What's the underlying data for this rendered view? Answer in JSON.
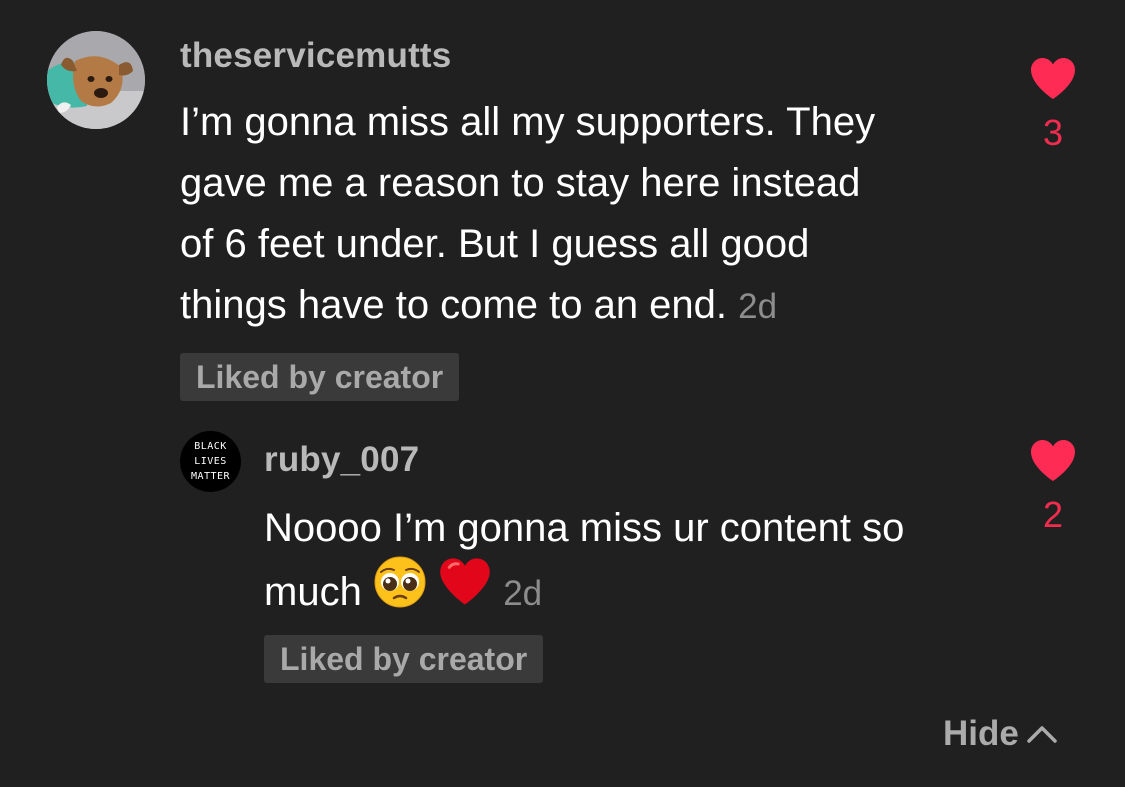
{
  "comment": {
    "username": "theservicemutts",
    "avatar_icon": "dog-avatar",
    "text_lines": [
      "I’m gonna miss all my supporters. They",
      "gave me a reason to stay here instead",
      "of 6 feet under. But I guess all good",
      "things have to come to an end."
    ],
    "time": "2d",
    "badge": "Liked by creator",
    "likes": "3"
  },
  "reply": {
    "username": "ruby_007",
    "avatar_lines": [
      "BLACK",
      "LIVES",
      "MATTER"
    ],
    "text_line1": "Noooo I’m gonna miss ur content so",
    "text_line2": "much",
    "emojis": [
      "pleading-face-emoji",
      "red-heart-emoji"
    ],
    "time": "2d",
    "badge": "Liked by creator",
    "likes": "2"
  },
  "hide": {
    "label": "Hide",
    "icon": "chevron-up-icon"
  },
  "colors": {
    "background": "#202020",
    "heart": "#fe2c55",
    "like_count": "#f02c4f",
    "badge_bg": "#3a3a3a",
    "username": "#b9b9b9"
  }
}
